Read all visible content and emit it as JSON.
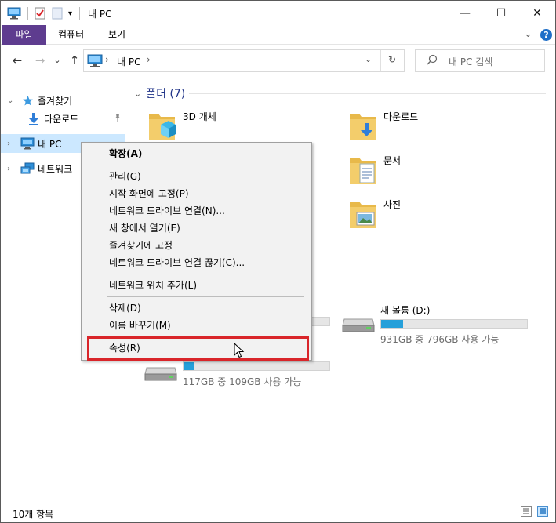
{
  "titlebar": {
    "title": "내 PC",
    "minimize": "—",
    "maximize": "☐",
    "close": "✕"
  },
  "ribbon": {
    "tabs": [
      "파일",
      "컴퓨터",
      "보기"
    ],
    "expand": "⌄",
    "help": "?"
  },
  "nav": {
    "back": "←",
    "forward": "→",
    "recent": "⌄",
    "up": "↑",
    "address_sep": "›",
    "address": "내 PC",
    "address_sep2": "›",
    "dropdown": "⌄",
    "refresh": "↻",
    "search_placeholder": "내 PC 검색"
  },
  "sidebar": {
    "items": [
      {
        "label": "즐겨찾기",
        "chev": "⌄"
      },
      {
        "label": "다운로드",
        "pin": "📌"
      },
      {
        "label": "내 PC",
        "chev": "›"
      },
      {
        "label": "네트워크",
        "chev": "›"
      }
    ]
  },
  "content": {
    "group_title": "폴더 (7)",
    "group_chev": "⌄",
    "folders": [
      "3D 개체",
      "다운로드",
      "문서",
      "사진"
    ],
    "drives": [
      {
        "name": "새 볼륨 (D:)",
        "info": "931GB 중 796GB 사용 가능",
        "used_fraction": 0.15
      },
      {
        "name": "",
        "info": "117GB 중 109GB 사용 가능",
        "used_fraction": 0.07
      }
    ]
  },
  "context_menu": {
    "items": [
      "확장(A)",
      "관리(G)",
      "시작 화면에 고정(P)",
      "네트워크 드라이브 연결(N)...",
      "새 창에서 열기(E)",
      "즐겨찾기에 고정",
      "네트워크 드라이브 연결 끊기(C)...",
      "네트워크 위치 추가(L)",
      "삭제(D)",
      "이름 바꾸기(M)",
      "속성(R)"
    ]
  },
  "status": {
    "count": "10개 항목"
  },
  "colors": {
    "file_tab": "#5e3c8f",
    "selection": "#cce8ff",
    "highlight_box": "#d9252a",
    "drive_bar": "#26a0da",
    "group_header": "#1e3287"
  }
}
